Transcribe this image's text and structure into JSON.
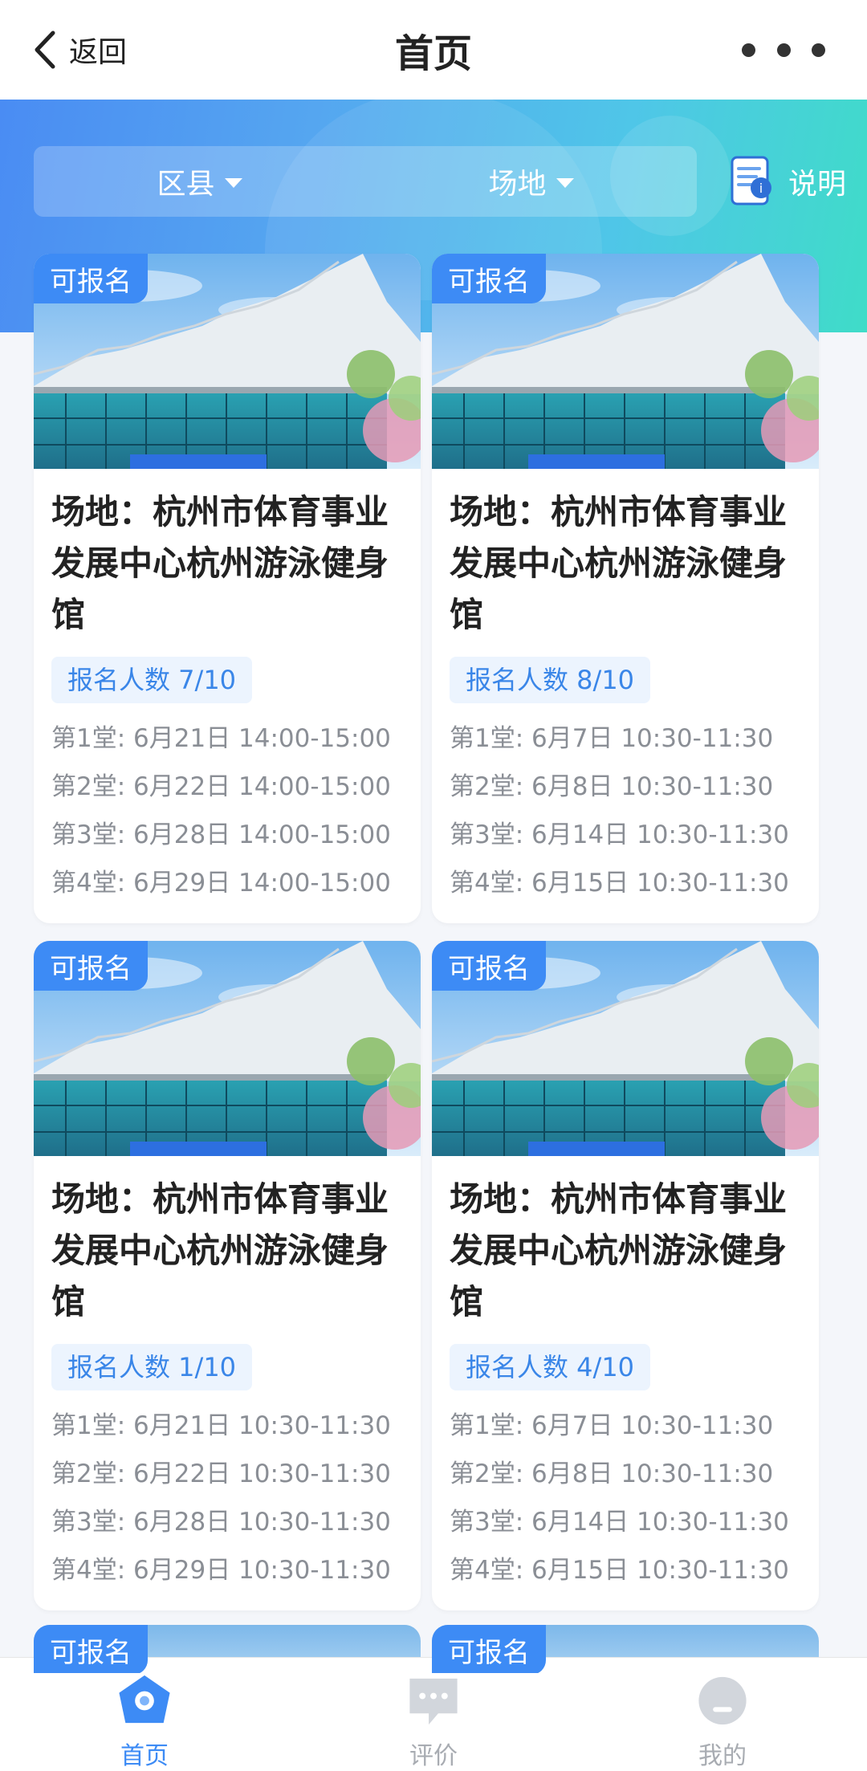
{
  "header": {
    "back_label": "返回",
    "title": "首页"
  },
  "filters": {
    "district": "区县",
    "venue": "场地",
    "explain": "说明"
  },
  "cards": [
    {
      "status": "可报名",
      "venue": "场地：杭州市体育事业发展中心杭州游泳健身馆",
      "count": "报名人数 7/10",
      "sessions": [
        "第1堂: 6月21日 14:00-15:00",
        "第2堂: 6月22日 14:00-15:00",
        "第3堂: 6月28日 14:00-15:00",
        "第4堂: 6月29日 14:00-15:00"
      ]
    },
    {
      "status": "可报名",
      "venue": "场地：杭州市体育事业发展中心杭州游泳健身馆",
      "count": "报名人数 8/10",
      "sessions": [
        "第1堂: 6月7日 10:30-11:30",
        "第2堂: 6月8日 10:30-11:30",
        "第3堂: 6月14日 10:30-11:30",
        "第4堂: 6月15日 10:30-11:30"
      ]
    },
    {
      "status": "可报名",
      "venue": "场地：杭州市体育事业发展中心杭州游泳健身馆",
      "count": "报名人数 1/10",
      "sessions": [
        "第1堂: 6月21日 10:30-11:30",
        "第2堂: 6月22日 10:30-11:30",
        "第3堂: 6月28日 10:30-11:30",
        "第4堂: 6月29日 10:30-11:30"
      ]
    },
    {
      "status": "可报名",
      "venue": "场地：杭州市体育事业发展中心杭州游泳健身馆",
      "count": "报名人数 4/10",
      "sessions": [
        "第1堂: 6月7日 10:30-11:30",
        "第2堂: 6月8日 10:30-11:30",
        "第3堂: 6月14日 10:30-11:30",
        "第4堂: 6月15日 10:30-11:30"
      ]
    }
  ],
  "partial_cards": [
    {
      "status": "可报名"
    },
    {
      "status": "可报名"
    }
  ],
  "tabbar": [
    {
      "label": "首页",
      "icon": "home-icon",
      "active": true
    },
    {
      "label": "评价",
      "icon": "comment-icon",
      "active": false
    },
    {
      "label": "我的",
      "icon": "profile-icon",
      "active": false
    }
  ],
  "colors": {
    "accent": "#3d8bf5",
    "count_bg": "#ecf4fe",
    "session_text": "#8a8e95"
  }
}
